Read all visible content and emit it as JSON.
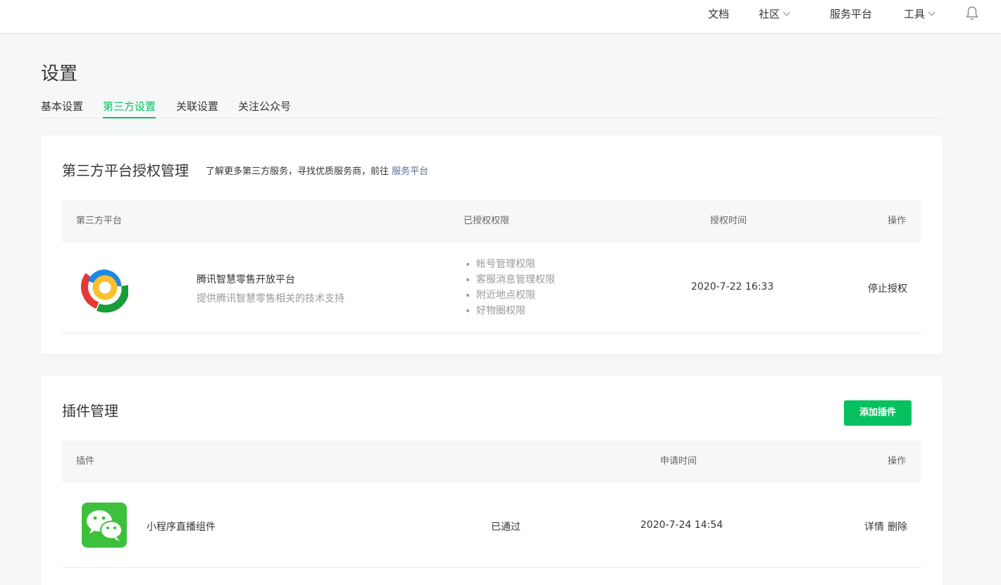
{
  "topnav": {
    "docs": "文档",
    "community": "社区",
    "service_platform": "服务平台",
    "tools": "工具"
  },
  "page": {
    "title": "设置",
    "tabs": [
      "基本设置",
      "第三方设置",
      "关联设置",
      "关注公众号"
    ],
    "active_tab": "第三方设置"
  },
  "third_party": {
    "title": "第三方平台授权管理",
    "subtitle": "了解更多第三方服务，寻找优质服务商，前往",
    "subtitle_link": "服务平台",
    "columns": [
      "第三方平台",
      "已授权权限",
      "授权时间",
      "操作"
    ],
    "rows": [
      {
        "name": "腾讯智慧零售开放平台",
        "desc": "提供腾讯智慧零售相关的技术支持",
        "permissions": [
          "帐号管理权限",
          "客服消息管理权限",
          "附近地点权限",
          "好物圈权限"
        ],
        "time": "2020-7-22 16:33",
        "action": "停止授权"
      }
    ]
  },
  "plugins": {
    "title": "插件管理",
    "add_button": "添加插件",
    "columns": [
      "插件",
      "申请时间",
      "操作"
    ],
    "rows": [
      {
        "name": "小程序直播组件",
        "status": "已通过",
        "time": "2020-7-24 14:54",
        "actions": [
          "详情",
          "删除"
        ]
      }
    ]
  },
  "colors": {
    "accent": "#07c160",
    "link": "#576b95"
  }
}
